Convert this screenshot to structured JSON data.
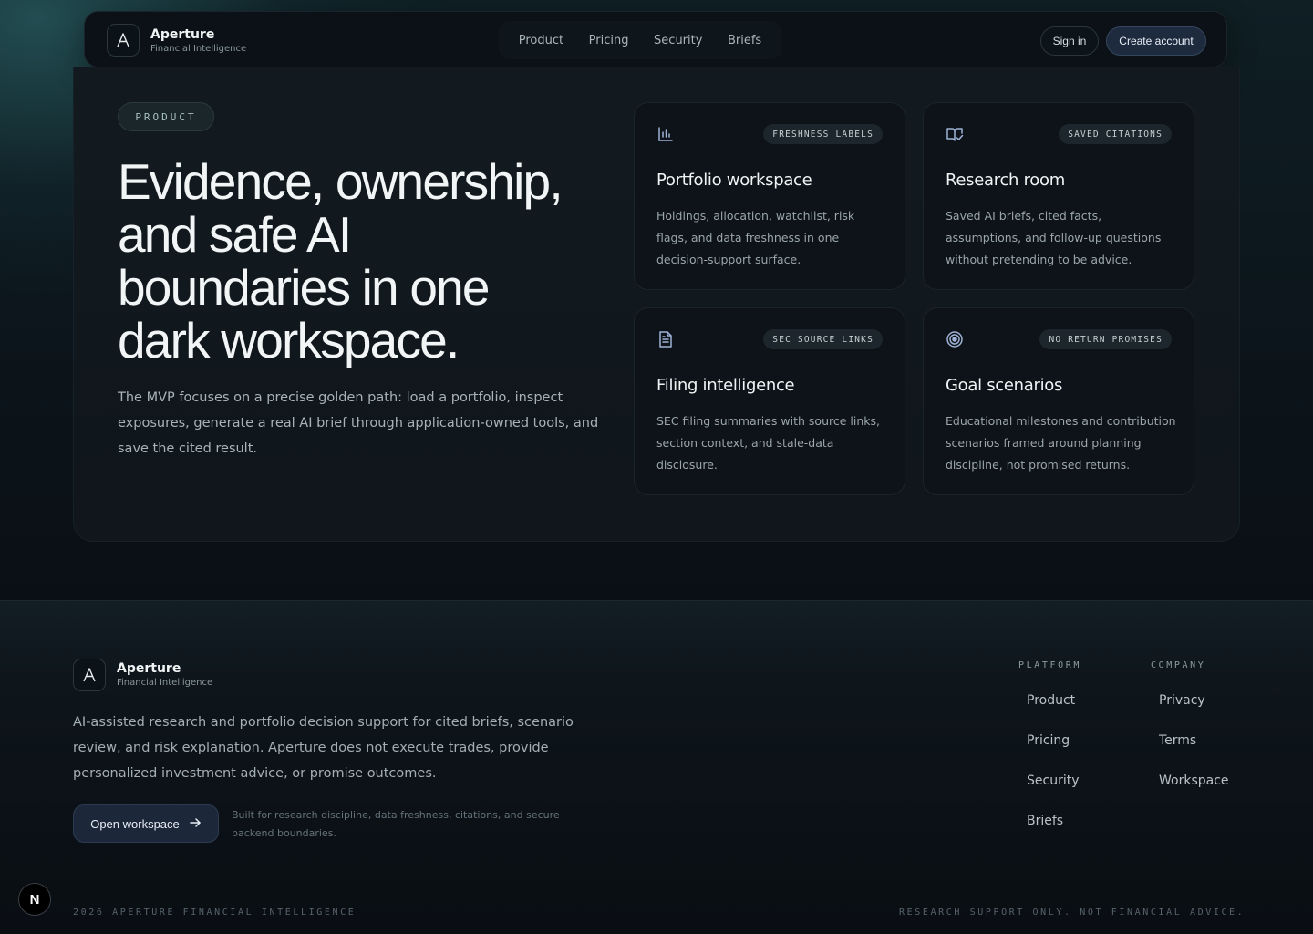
{
  "brand": {
    "name": "Aperture",
    "subtitle": "Financial Intelligence",
    "logo_icon": "aperture-a-logo"
  },
  "nav": {
    "links": [
      "Product",
      "Pricing",
      "Security",
      "Briefs"
    ],
    "sign_in": "Sign in",
    "create_account": "Create account"
  },
  "hero": {
    "eyebrow": "PRODUCT",
    "title_lines": [
      "Evidence, ownership,",
      "and safe AI",
      "boundaries in one",
      "dark workspace."
    ],
    "description": "The MVP focuses on a precise golden path: load a portfolio, inspect exposures, generate a real AI brief through application-owned tools, and save the cited result."
  },
  "cards": [
    {
      "icon": "bar-chart-icon",
      "badge": "FRESHNESS LABELS",
      "title": "Portfolio workspace",
      "description": "Holdings, allocation, watchlist, risk flags, and data freshness in one decision-support surface."
    },
    {
      "icon": "book-check-icon",
      "badge": "SAVED CITATIONS",
      "title": "Research room",
      "description": "Saved AI briefs, cited facts, assumptions, and follow-up questions without pretending to be advice."
    },
    {
      "icon": "document-icon",
      "badge": "SEC SOURCE LINKS",
      "title": "Filing intelligence",
      "description": "SEC filing summaries with source links, section context, and stale-data disclosure."
    },
    {
      "icon": "target-icon",
      "badge": "NO RETURN PROMISES",
      "title": "Goal scenarios",
      "description": "Educational milestones and contribution scenarios framed around planning discipline, not promised returns."
    }
  ],
  "footer": {
    "description": "AI-assisted research and portfolio decision support for cited briefs, scenario review, and risk explanation. Aperture does not execute trades, provide personalized investment advice, or promise outcomes.",
    "cta": "Open workspace",
    "cta_icon": "arrow-right-icon",
    "note": "Built for research discipline, data freshness, citations, and secure backend boundaries.",
    "columns": [
      {
        "heading": "PLATFORM",
        "links": [
          "Product",
          "Pricing",
          "Security",
          "Briefs"
        ]
      },
      {
        "heading": "COMPANY",
        "links": [
          "Privacy",
          "Terms",
          "Workspace"
        ]
      }
    ],
    "copyright": "2026 APERTURE FINANCIAL INTELLIGENCE",
    "disclaimer": "RESEARCH SUPPORT ONLY. NOT FINANCIAL ADVICE."
  },
  "dev_badge": "N"
}
